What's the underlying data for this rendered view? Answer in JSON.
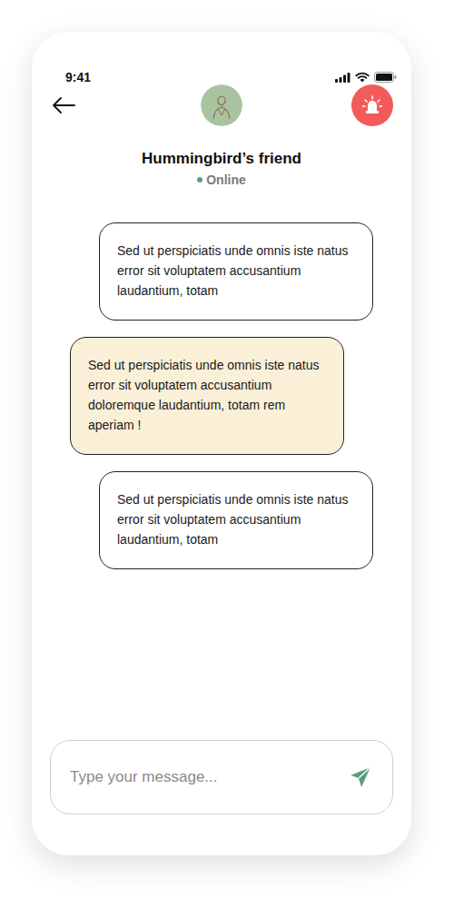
{
  "status_bar": {
    "time": "9:41"
  },
  "contact": {
    "name": "Hummingbird’s friend",
    "status": "Online"
  },
  "messages": [
    {
      "text": "Sed ut perspiciatis unde omnis iste natus error sit voluptatem accusantium laudantium, totam",
      "kind": "outgoing"
    },
    {
      "text": "Sed ut perspiciatis unde omnis iste natus error sit voluptatem accusantium doloremque laudantium, totam rem aperiam !",
      "kind": "incoming"
    },
    {
      "text": "Sed ut perspiciatis unde omnis iste natus error sit voluptatem accusantium laudantium, totam",
      "kind": "outgoing"
    }
  ],
  "composer": {
    "placeholder": "Type your message..."
  }
}
